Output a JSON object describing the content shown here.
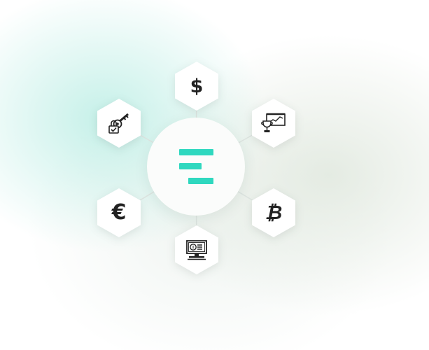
{
  "hub": {
    "logo_color": "#2fd8bf"
  },
  "nodes": [
    {
      "id": "dollar",
      "icon": "dollar-icon",
      "glyph": "$"
    },
    {
      "id": "trophy",
      "icon": "trophy-chart-icon"
    },
    {
      "id": "key",
      "icon": "key-lock-icon"
    },
    {
      "id": "euro",
      "icon": "euro-icon",
      "glyph": "€"
    },
    {
      "id": "btc",
      "icon": "bitcoin-icon",
      "glyph": "₿"
    },
    {
      "id": "screen",
      "icon": "monitor-coin-icon"
    }
  ],
  "colors": {
    "icon": "#222222",
    "hex_fill": "#ffffff",
    "connector": "#dde3df"
  }
}
